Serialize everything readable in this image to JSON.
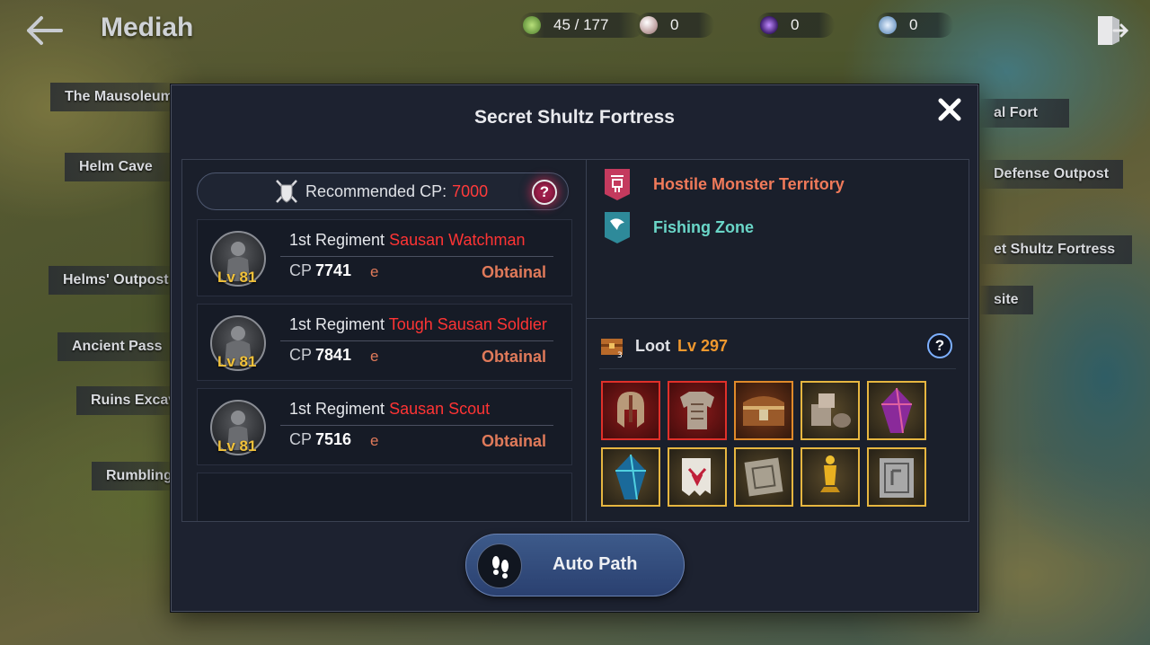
{
  "header": {
    "back_icon": "back-arrow-icon",
    "title": "Mediah",
    "exit_icon": "exit-door-icon"
  },
  "currencies": [
    {
      "icon": "energy-icon",
      "value": "45 / 177",
      "color": "#8bbf4a"
    },
    {
      "icon": "pearl-icon",
      "value": "0",
      "color": "#e8d8d8"
    },
    {
      "icon": "purple-gem-icon",
      "value": "0",
      "color": "#6a3aa8"
    },
    {
      "icon": "silver-coin-icon",
      "value": "0",
      "color": "#a8c8e8"
    }
  ],
  "map_labels": {
    "left": [
      "The Mausoleum",
      "Helm Cave",
      "Helms' Outpost",
      "Ancient Pass",
      "Ruins Excava",
      "Rumbling"
    ],
    "right": [
      "al Fort",
      "Defense Outpost",
      "et Shultz Fortress",
      "site"
    ]
  },
  "dialog": {
    "title": "Secret Shultz Fortress",
    "close_icon": "close-icon",
    "recommended": {
      "label": "Recommended CP:",
      "value": "7000"
    },
    "monsters": [
      {
        "level": "Lv 81",
        "regiment": "1st Regiment",
        "name": "Sausan Watchman",
        "cp_label": "CP",
        "cp": "7741",
        "cut": "e",
        "status": "Obtainal"
      },
      {
        "level": "Lv 81",
        "regiment": "1st Regiment",
        "name": "Tough Sausan Soldier",
        "cp_label": "CP",
        "cp": "7841",
        "cut": "e",
        "status": "Obtainal"
      },
      {
        "level": "Lv 81",
        "regiment": "1st Regiment",
        "name": "Sausan Scout",
        "cp_label": "CP",
        "cp": "7516",
        "cut": "e",
        "status": "Obtainal"
      }
    ],
    "zones": [
      {
        "label": "Hostile Monster Territory",
        "icon": "hostile-monster-icon",
        "color": "#f07a5a"
      },
      {
        "label": "Fishing Zone",
        "icon": "fishing-icon",
        "color": "#6ad6c8"
      }
    ],
    "loot": {
      "label": "Loot",
      "level": "Lv 297",
      "items": [
        {
          "icon": "helmet-icon",
          "rarity": "red"
        },
        {
          "icon": "armor-icon",
          "rarity": "red"
        },
        {
          "icon": "treasure-chest-icon",
          "rarity": "orange"
        },
        {
          "icon": "materials-icon",
          "rarity": "gold"
        },
        {
          "icon": "purple-crystal-icon",
          "rarity": "gold"
        },
        {
          "icon": "blue-crystal-icon",
          "rarity": "gold"
        },
        {
          "icon": "scroll-icon",
          "rarity": "gold"
        },
        {
          "icon": "stone-tablet-icon",
          "rarity": "gold"
        },
        {
          "icon": "golden-trophy-icon",
          "rarity": "gold"
        },
        {
          "icon": "book-icon",
          "rarity": "gold"
        }
      ]
    },
    "auto_path": "Auto Path"
  }
}
